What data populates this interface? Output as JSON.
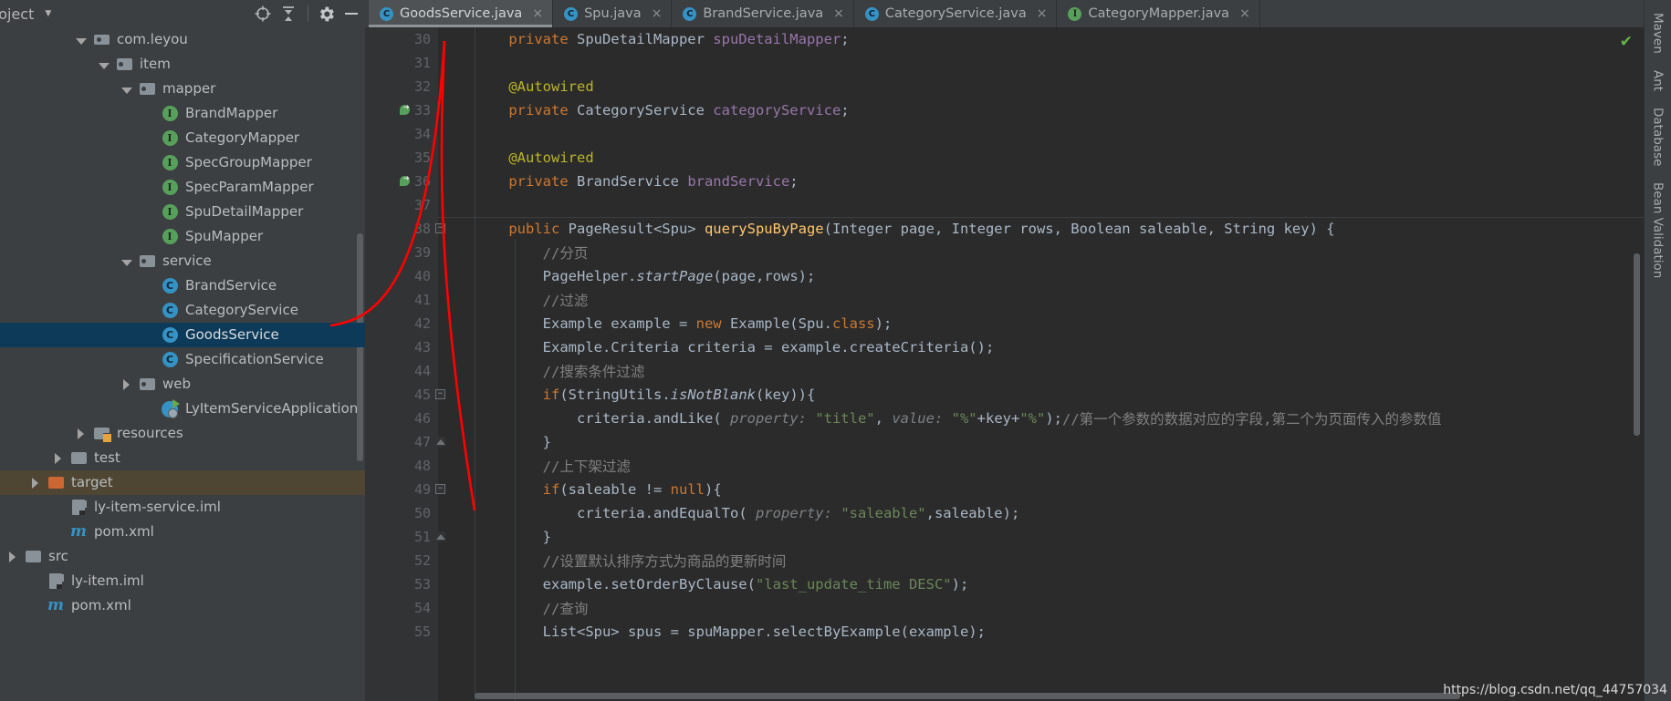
{
  "project_panel": {
    "title": "roject",
    "caret_icon": "chevron-down-icon",
    "toolbar": [
      {
        "name": "locate-icon",
        "glyph": "⊕"
      },
      {
        "name": "collapse-all-icon",
        "glyph": "⤓"
      },
      {
        "name": "settings-gear-icon",
        "glyph": "⚙"
      },
      {
        "name": "hide-icon",
        "glyph": "—"
      }
    ],
    "tree": [
      {
        "label": "com.leyou",
        "indent": 3,
        "arrow": "down",
        "icon": "package-icon"
      },
      {
        "label": "item",
        "indent": 4,
        "arrow": "down",
        "icon": "folder-icon"
      },
      {
        "label": "mapper",
        "indent": 5,
        "arrow": "down",
        "icon": "folder-icon"
      },
      {
        "label": "BrandMapper",
        "indent": 6,
        "arrow": "none",
        "icon": "interface-icon"
      },
      {
        "label": "CategoryMapper",
        "indent": 6,
        "arrow": "none",
        "icon": "interface-icon"
      },
      {
        "label": "SpecGroupMapper",
        "indent": 6,
        "arrow": "none",
        "icon": "interface-icon"
      },
      {
        "label": "SpecParamMapper",
        "indent": 6,
        "arrow": "none",
        "icon": "interface-icon"
      },
      {
        "label": "SpuDetailMapper",
        "indent": 6,
        "arrow": "none",
        "icon": "interface-icon"
      },
      {
        "label": "SpuMapper",
        "indent": 6,
        "arrow": "none",
        "icon": "interface-icon"
      },
      {
        "label": "service",
        "indent": 5,
        "arrow": "down",
        "icon": "folder-icon"
      },
      {
        "label": "BrandService",
        "indent": 6,
        "arrow": "none",
        "icon": "class-icon"
      },
      {
        "label": "CategoryService",
        "indent": 6,
        "arrow": "none",
        "icon": "class-icon"
      },
      {
        "label": "GoodsService",
        "indent": 6,
        "arrow": "none",
        "icon": "class-icon",
        "state": "selected"
      },
      {
        "label": "SpecificationService",
        "indent": 6,
        "arrow": "none",
        "icon": "class-icon"
      },
      {
        "label": "web",
        "indent": 5,
        "arrow": "right",
        "icon": "folder-icon"
      },
      {
        "label": "LyItemServiceApplication",
        "indent": 6,
        "arrow": "none",
        "icon": "spring-app-icon"
      },
      {
        "label": "resources",
        "indent": 3,
        "arrow": "right",
        "icon": "resources-folder-icon"
      },
      {
        "label": "test",
        "indent": 2,
        "arrow": "right",
        "icon": "folder-plain-icon"
      },
      {
        "label": "target",
        "indent": 1,
        "arrow": "right",
        "icon": "folder-orange-icon",
        "state": "highlight"
      },
      {
        "label": "ly-item-service.iml",
        "indent": 2,
        "arrow": "none",
        "icon": "iml-icon"
      },
      {
        "label": "pom.xml",
        "indent": 2,
        "arrow": "none",
        "icon": "maven-icon"
      },
      {
        "label": "src",
        "indent": 0,
        "arrow": "right",
        "icon": "folder-plain-icon"
      },
      {
        "label": "ly-item.iml",
        "indent": 1,
        "arrow": "none",
        "icon": "iml-icon"
      },
      {
        "label": "pom.xml",
        "indent": 1,
        "arrow": "none",
        "icon": "maven-icon"
      }
    ]
  },
  "editor_tabs": [
    {
      "label": "GoodsService.java",
      "icon": "class-icon",
      "active": true,
      "close": "×"
    },
    {
      "label": "Spu.java",
      "icon": "class-icon",
      "active": false,
      "close": "×"
    },
    {
      "label": "BrandService.java",
      "icon": "class-icon",
      "active": false,
      "close": "×"
    },
    {
      "label": "CategoryService.java",
      "icon": "class-icon",
      "active": false,
      "close": "×"
    },
    {
      "label": "CategoryMapper.java",
      "icon": "interface-icon",
      "active": false,
      "close": "×"
    }
  ],
  "editor": {
    "inspection_status_icon": "check-ok-icon",
    "first_line_number": 30,
    "lines": [
      {
        "n": 30,
        "marker": null,
        "fold": null,
        "tokens": [
          {
            "t": "    ",
            "c": "punct"
          },
          {
            "t": "private ",
            "c": "kw"
          },
          {
            "t": "SpuDetailMapper ",
            "c": "type"
          },
          {
            "t": "spuDetailMapper",
            "c": "fld"
          },
          {
            "t": ";",
            "c": "punct"
          }
        ]
      },
      {
        "n": 31,
        "marker": null,
        "fold": null,
        "tokens": []
      },
      {
        "n": 32,
        "marker": null,
        "fold": null,
        "tokens": [
          {
            "t": "    ",
            "c": "punct"
          },
          {
            "t": "@Autowired",
            "c": "ann"
          }
        ]
      },
      {
        "n": 33,
        "marker": "override-icon",
        "fold": null,
        "tokens": [
          {
            "t": "    ",
            "c": "punct"
          },
          {
            "t": "private ",
            "c": "kw"
          },
          {
            "t": "CategoryService ",
            "c": "type"
          },
          {
            "t": "categoryService",
            "c": "fld"
          },
          {
            "t": ";",
            "c": "punct"
          }
        ]
      },
      {
        "n": 34,
        "marker": null,
        "fold": null,
        "tokens": []
      },
      {
        "n": 35,
        "marker": null,
        "fold": null,
        "tokens": [
          {
            "t": "    ",
            "c": "punct"
          },
          {
            "t": "@Autowired",
            "c": "ann"
          }
        ]
      },
      {
        "n": 36,
        "marker": "override-icon",
        "fold": null,
        "tokens": [
          {
            "t": "    ",
            "c": "punct"
          },
          {
            "t": "private ",
            "c": "kw"
          },
          {
            "t": "BrandService ",
            "c": "type"
          },
          {
            "t": "brandService",
            "c": "fld"
          },
          {
            "t": ";",
            "c": "punct"
          }
        ]
      },
      {
        "n": 37,
        "marker": null,
        "fold": null,
        "tokens": []
      },
      {
        "n": 38,
        "marker": null,
        "fold": "start",
        "sep": true,
        "tokens": [
          {
            "t": "    ",
            "c": "punct"
          },
          {
            "t": "public ",
            "c": "kw"
          },
          {
            "t": "PageResult<Spu> ",
            "c": "type"
          },
          {
            "t": "querySpuByPage",
            "c": "mth"
          },
          {
            "t": "(",
            "c": "br"
          },
          {
            "t": "Integer ",
            "c": "type"
          },
          {
            "t": "page",
            "c": "punct"
          },
          {
            "t": ", ",
            "c": "punct"
          },
          {
            "t": "Integer ",
            "c": "type"
          },
          {
            "t": "rows",
            "c": "punct"
          },
          {
            "t": ", ",
            "c": "punct"
          },
          {
            "t": "Boolean ",
            "c": "type"
          },
          {
            "t": "saleable",
            "c": "punct"
          },
          {
            "t": ", ",
            "c": "punct"
          },
          {
            "t": "String ",
            "c": "type"
          },
          {
            "t": "key",
            "c": "punct"
          },
          {
            "t": ")",
            "c": "br"
          },
          {
            "t": " {",
            "c": "punct"
          }
        ]
      },
      {
        "n": 39,
        "marker": null,
        "fold": null,
        "tokens": [
          {
            "t": "        ",
            "c": "punct"
          },
          {
            "t": "//分页",
            "c": "cmt"
          }
        ]
      },
      {
        "n": 40,
        "marker": null,
        "fold": null,
        "tokens": [
          {
            "t": "        ",
            "c": "punct"
          },
          {
            "t": "PageHelper",
            "c": "type"
          },
          {
            "t": ".",
            "c": "punct"
          },
          {
            "t": "startPage",
            "c": "statmth"
          },
          {
            "t": "(",
            "c": "br"
          },
          {
            "t": "page,rows",
            "c": "punct"
          },
          {
            "t": ")",
            "c": "br"
          },
          {
            "t": ";",
            "c": "punct"
          }
        ]
      },
      {
        "n": 41,
        "marker": null,
        "fold": null,
        "tokens": [
          {
            "t": "        ",
            "c": "punct"
          },
          {
            "t": "//过滤",
            "c": "cmt"
          }
        ]
      },
      {
        "n": 42,
        "marker": null,
        "fold": null,
        "tokens": [
          {
            "t": "        ",
            "c": "punct"
          },
          {
            "t": "Example example = ",
            "c": "type"
          },
          {
            "t": "new ",
            "c": "kw"
          },
          {
            "t": "Example",
            "c": "type"
          },
          {
            "t": "(",
            "c": "br"
          },
          {
            "t": "Spu",
            "c": "type"
          },
          {
            "t": ".",
            "c": "punct"
          },
          {
            "t": "class",
            "c": "kw"
          },
          {
            "t": ")",
            "c": "br"
          },
          {
            "t": ";",
            "c": "punct"
          }
        ]
      },
      {
        "n": 43,
        "marker": null,
        "fold": null,
        "tokens": [
          {
            "t": "        ",
            "c": "punct"
          },
          {
            "t": "Example.Criteria criteria = example",
            "c": "type"
          },
          {
            "t": ".",
            "c": "punct"
          },
          {
            "t": "createCriteria",
            "c": "mthcall"
          },
          {
            "t": "()",
            "c": "br"
          },
          {
            "t": ";",
            "c": "punct"
          }
        ]
      },
      {
        "n": 44,
        "marker": null,
        "fold": null,
        "tokens": [
          {
            "t": "        ",
            "c": "punct"
          },
          {
            "t": "//搜索条件过滤",
            "c": "cmt"
          }
        ]
      },
      {
        "n": 45,
        "marker": null,
        "fold": "start",
        "tokens": [
          {
            "t": "        ",
            "c": "punct"
          },
          {
            "t": "if",
            "c": "kw"
          },
          {
            "t": "(",
            "c": "br"
          },
          {
            "t": "StringUtils",
            "c": "type"
          },
          {
            "t": ".",
            "c": "punct"
          },
          {
            "t": "isNotBlank",
            "c": "statmth"
          },
          {
            "t": "(",
            "c": "br"
          },
          {
            "t": "key",
            "c": "punct"
          },
          {
            "t": "))",
            "c": "br"
          },
          {
            "t": "{",
            "c": "punct"
          }
        ]
      },
      {
        "n": 46,
        "marker": null,
        "fold": null,
        "tokens": [
          {
            "t": "            ",
            "c": "punct"
          },
          {
            "t": "criteria",
            "c": "type"
          },
          {
            "t": ".",
            "c": "punct"
          },
          {
            "t": "andLike",
            "c": "mthcall"
          },
          {
            "t": "(",
            "c": "br"
          },
          {
            "t": " property: ",
            "c": "param-hint"
          },
          {
            "t": "\"title\"",
            "c": "str"
          },
          {
            "t": ", ",
            "c": "punct"
          },
          {
            "t": "value: ",
            "c": "param-hint"
          },
          {
            "t": "\"%\"",
            "c": "str"
          },
          {
            "t": "+",
            "c": "punct"
          },
          {
            "t": "key",
            "c": "punct"
          },
          {
            "t": "+",
            "c": "punct"
          },
          {
            "t": "\"%\"",
            "c": "str"
          },
          {
            "t": ")",
            "c": "br"
          },
          {
            "t": ";",
            "c": "punct"
          },
          {
            "t": "//第一个参数的数据对应的字段,第二个为页面传入的参数值",
            "c": "cmt"
          }
        ]
      },
      {
        "n": 47,
        "marker": null,
        "fold": "end",
        "tokens": [
          {
            "t": "        ",
            "c": "punct"
          },
          {
            "t": "}",
            "c": "punct"
          }
        ]
      },
      {
        "n": 48,
        "marker": null,
        "fold": null,
        "tokens": [
          {
            "t": "        ",
            "c": "punct"
          },
          {
            "t": "//上下架过滤",
            "c": "cmt"
          }
        ]
      },
      {
        "n": 49,
        "marker": null,
        "fold": "start",
        "tokens": [
          {
            "t": "        ",
            "c": "punct"
          },
          {
            "t": "if",
            "c": "kw"
          },
          {
            "t": "(",
            "c": "br"
          },
          {
            "t": "saleable != ",
            "c": "punct"
          },
          {
            "t": "null",
            "c": "kw"
          },
          {
            "t": ")",
            "c": "br"
          },
          {
            "t": "{",
            "c": "punct"
          }
        ]
      },
      {
        "n": 50,
        "marker": null,
        "fold": null,
        "tokens": [
          {
            "t": "            ",
            "c": "punct"
          },
          {
            "t": "criteria",
            "c": "type"
          },
          {
            "t": ".",
            "c": "punct"
          },
          {
            "t": "andEqualTo",
            "c": "mthcall"
          },
          {
            "t": "(",
            "c": "br"
          },
          {
            "t": " property: ",
            "c": "param-hint"
          },
          {
            "t": "\"saleable\"",
            "c": "str"
          },
          {
            "t": ",saleable",
            "c": "punct"
          },
          {
            "t": ")",
            "c": "br"
          },
          {
            "t": ";",
            "c": "punct"
          }
        ]
      },
      {
        "n": 51,
        "marker": null,
        "fold": "end",
        "tokens": [
          {
            "t": "        ",
            "c": "punct"
          },
          {
            "t": "}",
            "c": "punct"
          }
        ]
      },
      {
        "n": 52,
        "marker": null,
        "fold": null,
        "tokens": [
          {
            "t": "        ",
            "c": "punct"
          },
          {
            "t": "//设置默认排序方式为商品的更新时间",
            "c": "cmt"
          }
        ]
      },
      {
        "n": 53,
        "marker": null,
        "fold": null,
        "tokens": [
          {
            "t": "        ",
            "c": "punct"
          },
          {
            "t": "example",
            "c": "type"
          },
          {
            "t": ".",
            "c": "punct"
          },
          {
            "t": "setOrderByClause",
            "c": "mthcall"
          },
          {
            "t": "(",
            "c": "br"
          },
          {
            "t": "\"last_update_time DESC\"",
            "c": "str"
          },
          {
            "t": ")",
            "c": "br"
          },
          {
            "t": ";",
            "c": "punct"
          }
        ]
      },
      {
        "n": 54,
        "marker": null,
        "fold": null,
        "tokens": [
          {
            "t": "        ",
            "c": "punct"
          },
          {
            "t": "//查询",
            "c": "cmt"
          }
        ]
      },
      {
        "n": 55,
        "marker": null,
        "fold": null,
        "tokens": [
          {
            "t": "        ",
            "c": "punct"
          },
          {
            "t": "List<Spu> spus = spuMapper",
            "c": "type"
          },
          {
            "t": ".",
            "c": "punct"
          },
          {
            "t": "selectByExample",
            "c": "mthcall"
          },
          {
            "t": "(",
            "c": "br"
          },
          {
            "t": "example",
            "c": "punct"
          },
          {
            "t": ")",
            "c": "br"
          },
          {
            "t": ";",
            "c": "punct"
          }
        ]
      }
    ]
  },
  "right_tool_strip": [
    {
      "label": "Maven",
      "icon": "maven-icon"
    },
    {
      "label": "Ant",
      "icon": "ant-icon"
    },
    {
      "label": "Database",
      "icon": "database-icon"
    },
    {
      "label": "Bean Validation",
      "icon": "bean-validation-icon"
    }
  ],
  "watermark": "https://blog.csdn.net/qq_44757034",
  "colors": {
    "panel_bg": "#3c3f41",
    "editor_bg": "#2b2b2b",
    "gutter_bg": "#313335",
    "selection_blue": "#0d3a58",
    "highlight_olive": "#4e4632",
    "annotation_red": "#ff0000",
    "keyword_orange": "#cc7832",
    "string_green": "#6a8759",
    "comment_gray": "#808080",
    "field_purple": "#9876aa",
    "method_yellow": "#ffc66d",
    "annotation_yellow": "#bbb529",
    "number_blue": "#6897bb",
    "text_default": "#a9b7c6"
  }
}
